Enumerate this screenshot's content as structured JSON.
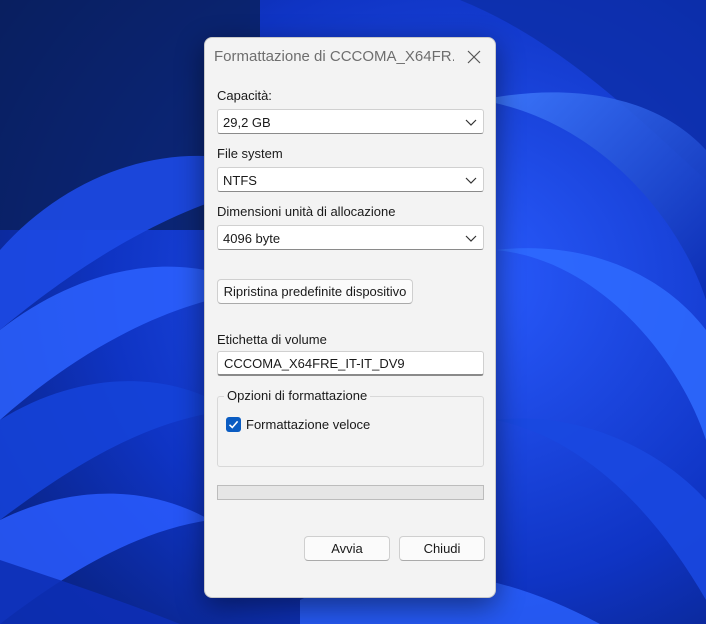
{
  "window": {
    "title": "Formattazione di CCCOMA_X64FR..."
  },
  "capacity": {
    "label": "Capacità:",
    "value": "29,2 GB"
  },
  "file_system": {
    "label": "File system",
    "value": "NTFS"
  },
  "allocation": {
    "label": "Dimensioni unità di allocazione",
    "value": "4096 byte"
  },
  "restore_button": {
    "label": "Ripristina predefinite dispositivo"
  },
  "volume_label": {
    "label": "Etichetta di volume",
    "value": "CCCOMA_X64FRE_IT-IT_DV9"
  },
  "format_options": {
    "title": "Opzioni di formattazione",
    "quick_format": {
      "label": "Formattazione veloce",
      "checked": true
    }
  },
  "progress": {
    "value": 0
  },
  "buttons": {
    "start": "Avvia",
    "close": "Chiudi"
  },
  "icons": {
    "close": "close-icon",
    "dropdown": "chevron-down-icon",
    "check": "checkmark-icon"
  },
  "colors": {
    "accent": "#0a5cc2",
    "wallpaper": "#1740d4",
    "dialog_bg": "#f3f3f3"
  }
}
